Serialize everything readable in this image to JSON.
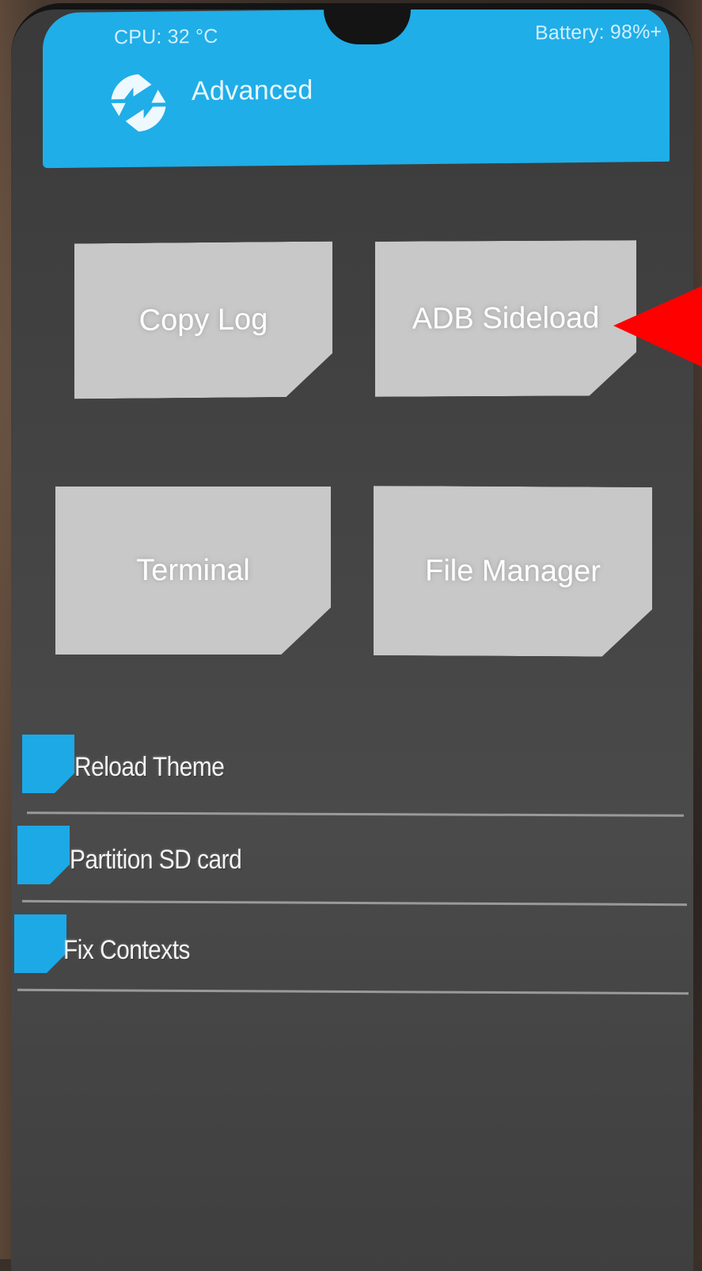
{
  "status_bar": {
    "cpu": "CPU: 32 °C",
    "battery": "Battery: 98%+"
  },
  "header": {
    "title": "Advanced",
    "logo_icon": "twrp-logo-icon",
    "color": "#1faee8"
  },
  "tiles": [
    {
      "label": "Copy Log"
    },
    {
      "label": "ADB Sideload"
    },
    {
      "label": "Terminal"
    },
    {
      "label": "File Manager"
    }
  ],
  "list": [
    {
      "label": "Reload Theme"
    },
    {
      "label": "Partition SD card"
    },
    {
      "label": "Fix Contexts"
    }
  ],
  "annotation": {
    "arrow_icon": "red-arrow-icon",
    "color": "#ff0000"
  }
}
